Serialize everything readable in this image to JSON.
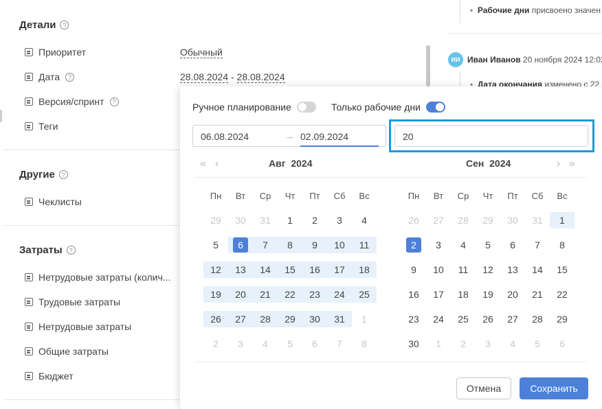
{
  "details": {
    "title": "Детали",
    "rows": [
      {
        "label": "Приоритет",
        "value": "Обычный"
      },
      {
        "label": "Дата",
        "value_start": "28.08.2024",
        "value_sep": "-",
        "value_end": "28.08.2024"
      },
      {
        "label": "Версия/спринт"
      },
      {
        "label": "Теги"
      }
    ]
  },
  "other": {
    "title": "Другие",
    "rows": [
      {
        "label": "Чеклисты"
      }
    ]
  },
  "costs": {
    "title": "Затраты",
    "rows": [
      {
        "label": "Нетрудовые затраты (колич..."
      },
      {
        "label": "Трудовые затраты"
      },
      {
        "label": "Нетрудовые затраты"
      },
      {
        "label": "Общие затраты"
      },
      {
        "label": "Бюджет"
      }
    ]
  },
  "activity": {
    "item1": {
      "bold": "Рабочие дни",
      "text": "присвоено значен"
    },
    "author": {
      "initials": "ИИ",
      "name": "Иван Иванов",
      "date": "20 ноября 2024 12:02"
    },
    "item2": {
      "bold": "Дата окончания",
      "text": "изменено с 22"
    }
  },
  "popup": {
    "manual_label": "Ручное планирование",
    "workdays_label": "Только рабочие дни",
    "start_date": "06.08.2024",
    "arrow": "→",
    "end_date": "02.09.2024",
    "days_value": "20",
    "nav": {
      "prev_year": "«",
      "prev_month": "‹",
      "next_month": "›",
      "next_year": "»"
    },
    "left_month": {
      "name": "Авг",
      "year": "2024"
    },
    "right_month": {
      "name": "Сен",
      "year": "2024"
    },
    "weekdays": [
      "Пн",
      "Вт",
      "Ср",
      "Чт",
      "Пт",
      "Сб",
      "Вс"
    ],
    "cancel": "Отмена",
    "save": "Сохранить"
  },
  "colors": {
    "accent": "#4c80d9",
    "range_bg": "#e6f1fb",
    "highlight_box": "#1e9ad6"
  }
}
